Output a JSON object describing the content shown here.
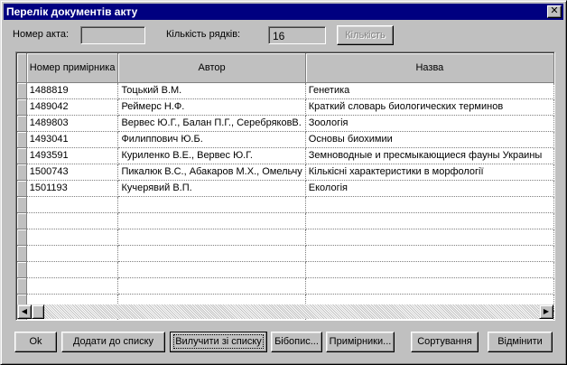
{
  "window": {
    "title": "Перелік документів акту",
    "close_glyph": "✕"
  },
  "header": {
    "act_number_label": "Номер акта:",
    "act_number_value": "",
    "row_count_label": "Кількість рядків:",
    "row_count_value": "16",
    "count_button": "Кількість"
  },
  "grid": {
    "columns": [
      "Номер примірника",
      "Автор",
      "Назва"
    ],
    "rows": [
      [
        "1488819",
        "Тоцький В.М.",
        "Генетика"
      ],
      [
        "1489042",
        "Реймерс Н.Ф.",
        "Краткий словарь биологических терминов"
      ],
      [
        "1489803",
        "Вервес Ю.Г., Балан П.Г., СеребряковВ.",
        "Зоологія"
      ],
      [
        "1493041",
        "Филиппович Ю.Б.",
        "Основы биохимии"
      ],
      [
        "1493591",
        "Куриленко В.Е., Вервес Ю.Г.",
        "Земноводные и пресмыкающиеся фауны Украины"
      ],
      [
        "1500743",
        "Пикалюк В.С., Абакаров М.Х., Омельчу",
        "Кількісні характеристики в морфології"
      ],
      [
        "1501193",
        "Кучерявий В.П.",
        "Екологія"
      ],
      [
        "",
        "",
        ""
      ],
      [
        "",
        "",
        ""
      ],
      [
        "",
        "",
        ""
      ],
      [
        "",
        "",
        ""
      ],
      [
        "",
        "",
        ""
      ],
      [
        "",
        "",
        ""
      ],
      [
        "",
        "",
        ""
      ],
      [
        "",
        "",
        ""
      ],
      [
        "",
        "",
        ""
      ]
    ]
  },
  "scrollbar": {
    "left_glyph": "◀",
    "right_glyph": "▶"
  },
  "buttons": {
    "ok": "Ok",
    "add": "Додати до списку",
    "remove": "Вилучити зі списку",
    "bibopis": "Бібопис...",
    "copies": "Примірники...",
    "sort": "Сортування",
    "cancel": "Відмінити"
  }
}
